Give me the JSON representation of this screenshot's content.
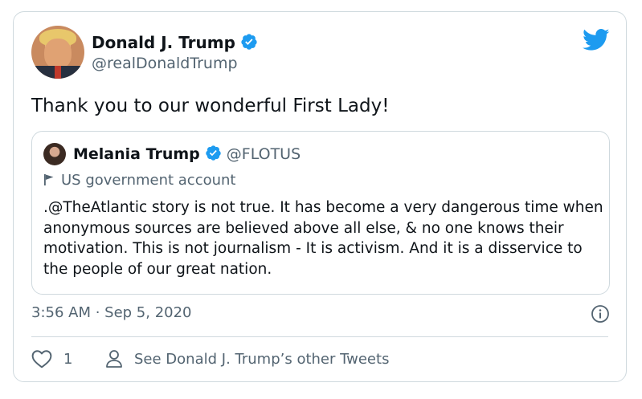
{
  "author": {
    "name": "Donald J. Trump",
    "handle": "@realDonaldTrump"
  },
  "tweet_text": "Thank you to our wonderful First Lady!",
  "quoted": {
    "name": "Melania Trump",
    "handle": "@FLOTUS",
    "label": "US government account",
    "text": ".@TheAtlantic story is not true. It has become a very dangerous time when anonymous sources are believed above all else, & no one knows their motivation. This is not journalism - It is activism. And it is a disservice to the people of our great nation."
  },
  "timestamp": "3:56 AM · Sep 5, 2020",
  "actions": {
    "like_count": "1",
    "other_tweets": "See Donald J. Trump’s other Tweets"
  },
  "colors": {
    "verified": "#1d9bf0",
    "twitter_blue": "#1d9bf0",
    "secondary_text": "#536471",
    "border": "#cfd9de"
  },
  "icons": [
    "verified-icon",
    "twitter-bird-icon",
    "flag-icon",
    "info-icon",
    "heart-icon",
    "person-icon"
  ]
}
